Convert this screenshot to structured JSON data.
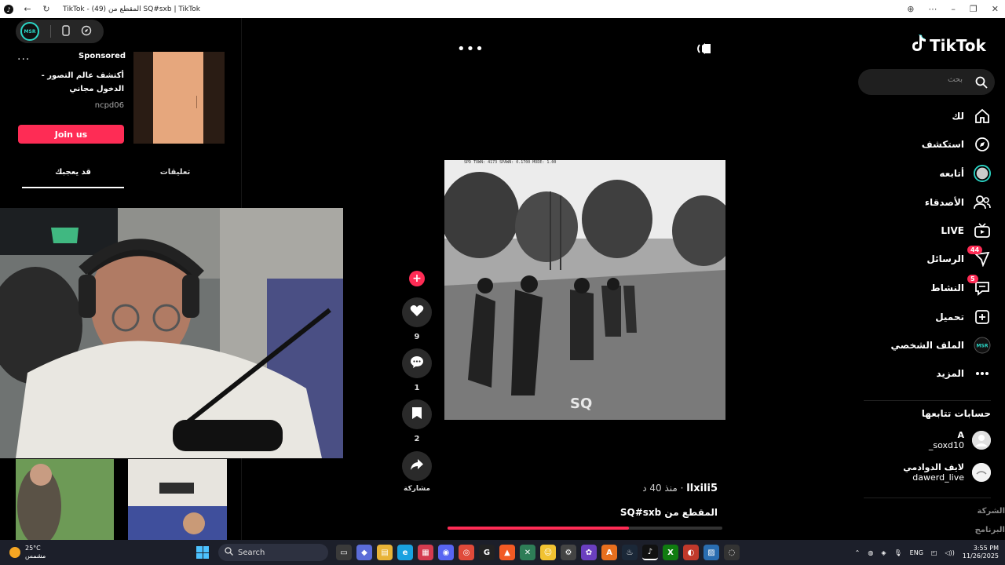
{
  "browser": {
    "tab_title": "TikTok - (49) المقطع من SQ#sxb | TikTok"
  },
  "ad": {
    "menu_dots": "...",
    "sponsored": "Sponsored",
    "title": "أكتشف عالم التصور - الدخول مجاني",
    "account": "ncpd06",
    "cta": "Join us"
  },
  "left_tabs": [
    {
      "label": "قد يعجبك",
      "active": true
    },
    {
      "label": "تعليقات",
      "active": false
    }
  ],
  "video": {
    "top_dots": "•••",
    "watermark": "SQ",
    "hud": "SPD TOWN: 4173  SPAWN: 0.1700  MODE: 1.00",
    "author": "llxili5",
    "time_ago": "منذ 40 د",
    "caption": "المقطع من SQ#sxb",
    "progress": 0.66
  },
  "actions": {
    "like_count": "9",
    "comment_count": "1",
    "bookmark_count": "2",
    "share_label": "مشاركة"
  },
  "sidebar": {
    "brand": "TikTok",
    "search_placeholder": "بحث",
    "nav": [
      {
        "label": "لك",
        "icon": "home-icon"
      },
      {
        "label": "استكشف",
        "icon": "compass-icon"
      },
      {
        "label": "أتابعه",
        "icon": "following-icon"
      },
      {
        "label": "الأصدقاء",
        "icon": "friends-icon"
      },
      {
        "label": "LIVE",
        "icon": "live-icon"
      },
      {
        "label": "الرسائل",
        "icon": "messages-icon",
        "badge": "44"
      },
      {
        "label": "النشاط",
        "icon": "activity-icon",
        "badge": "5"
      },
      {
        "label": "تحميل",
        "icon": "upload-icon"
      },
      {
        "label": "الملف الشخصي",
        "icon": "profile-icon"
      },
      {
        "label": "المزيد",
        "icon": "more-icon"
      }
    ],
    "following_header": "حسابات تتابعها",
    "following": [
      {
        "name": "A",
        "handle": "_soxd10"
      },
      {
        "name": "لايف الدوادمي",
        "handle": "dawerd_live"
      }
    ],
    "footer": [
      "الشركة",
      "البرنامج"
    ]
  },
  "taskbar": {
    "temperature": "25°C",
    "weather": "مشمس",
    "search": "Search",
    "lang": "ENG",
    "time": "3:55 PM",
    "date": "11/26/2025"
  },
  "colors": {
    "accent": "#fe2c55",
    "teal": "#2bd6c6"
  }
}
